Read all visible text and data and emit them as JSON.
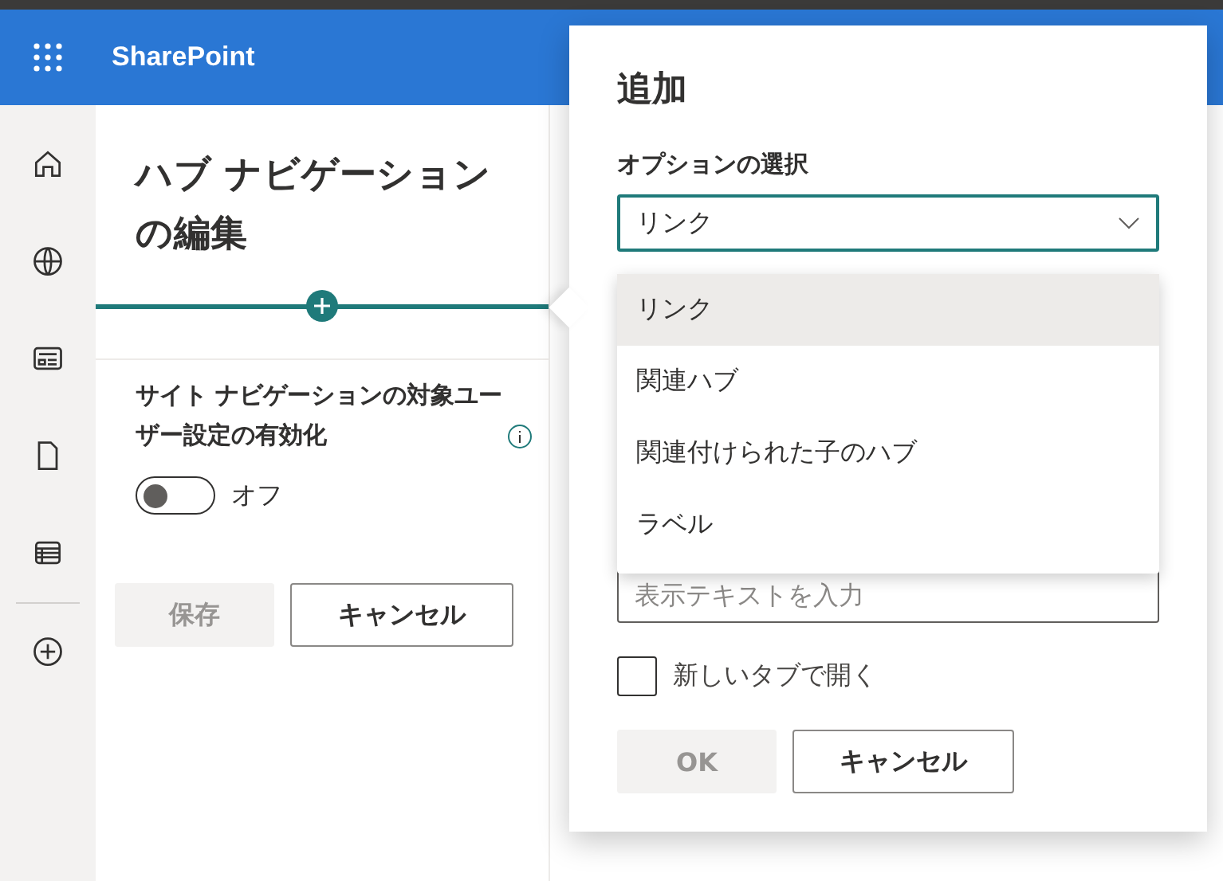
{
  "header": {
    "app_name": "SharePoint"
  },
  "panel": {
    "title": "ハブ ナビゲーションの編集",
    "setting_label": "サイト ナビゲーションの対象ユーザー設定の有効化",
    "toggle": {
      "on": false,
      "label": "オフ"
    },
    "buttons": [
      {
        "label": "保存",
        "disabled": true
      },
      {
        "label": "キャンセル",
        "disabled": false
      }
    ]
  },
  "dialog": {
    "title": "追加",
    "option_label": "オプションの選択",
    "dropdown": {
      "value": "リンク",
      "expanded": true,
      "options": [
        {
          "label": "リンク",
          "selected": true
        },
        {
          "label": "関連ハブ",
          "selected": false
        },
        {
          "label": "関連付けられた子のハブ",
          "selected": false
        },
        {
          "label": "ラベル",
          "selected": false
        }
      ]
    },
    "text_field": {
      "placeholder": "表示テキストを入力"
    },
    "checkbox": {
      "label": "新しいタブで開く",
      "checked": false
    },
    "buttons": [
      {
        "label": "OK",
        "disabled": true
      },
      {
        "label": "キャンセル",
        "disabled": false
      }
    ]
  }
}
